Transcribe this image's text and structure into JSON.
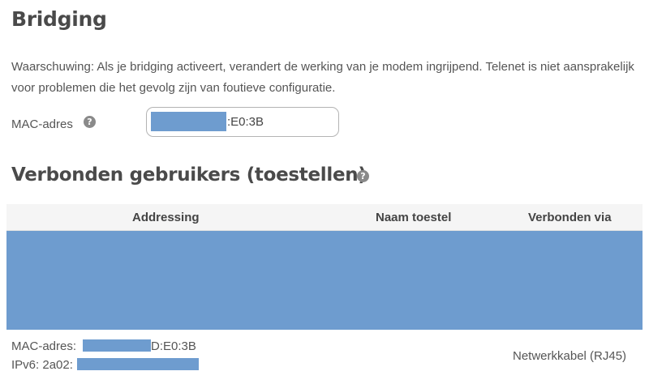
{
  "bridging": {
    "title": "Bridging",
    "warning": "Waarschuwing: Als je bridging activeert, verandert de werking van je modem ingrijpend. Telenet is niet aansprakelijk voor problemen die het gevolg zijn van foutieve configuratie.",
    "mac_label": "MAC-adres",
    "help_glyph": "?",
    "mac_value_suffix": ":E0:3B"
  },
  "devices": {
    "title": "Verbonden gebruikers (toestellen)",
    "help_glyph": "?",
    "columns": [
      "Addressing",
      "Naam toestel",
      "Verbonden via"
    ],
    "rows": [
      {
        "mac_prefix": "MAC-adres: ",
        "mac_suffix": "D:E0:3B",
        "ipv6_prefix": "IPv6: 2a02:",
        "connected_via": "Netwerkkabel (RJ45)"
      }
    ]
  },
  "colors": {
    "redaction": "#6e9ccf",
    "heading": "#4a4a4a"
  }
}
